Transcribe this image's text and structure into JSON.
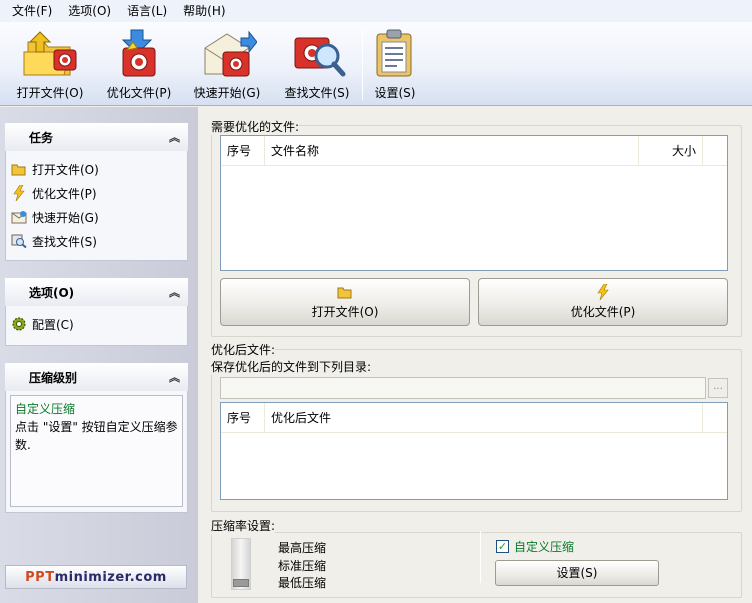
{
  "menubar": {
    "items": [
      "文件(F)",
      "选项(O)",
      "语言(L)",
      "帮助(H)"
    ]
  },
  "toolbar": {
    "open": "打开文件(O)",
    "optimize": "优化文件(P)",
    "quickstart": "快速开始(G)",
    "find": "查找文件(S)",
    "settings": "设置(S)"
  },
  "sidebar": {
    "tasks": {
      "title": "任务",
      "items": [
        "打开文件(O)",
        "优化文件(P)",
        "快速开始(G)",
        "查找文件(S)"
      ]
    },
    "options": {
      "title": "选项(O)",
      "items": [
        "配置(C)"
      ]
    },
    "compression": {
      "title": "压缩级别",
      "mode": "自定义压缩",
      "description": "点击 \"设置\" 按钮自定义压缩参数."
    },
    "logo": {
      "part1": "PPT",
      "part2": "minimizer.com"
    }
  },
  "main": {
    "files_group": {
      "label": "需要优化的文件:",
      "columns": [
        "序号",
        "文件名称",
        "大小"
      ]
    },
    "open_button": "打开文件(O)",
    "optimize_button": "优化文件(P)",
    "output_group": {
      "label": "优化后文件:",
      "save_label": "保存优化后的文件到下列目录:",
      "path_value": "",
      "browse": "...",
      "columns": [
        "序号",
        "优化后文件"
      ]
    },
    "compression_settings": {
      "label": "压缩率设置:",
      "levels": [
        "最高压缩",
        "标准压缩",
        "最低压缩"
      ],
      "custom_checkbox": "自定义压缩",
      "custom_checked": true,
      "settings_button": "设置(S)"
    }
  }
}
